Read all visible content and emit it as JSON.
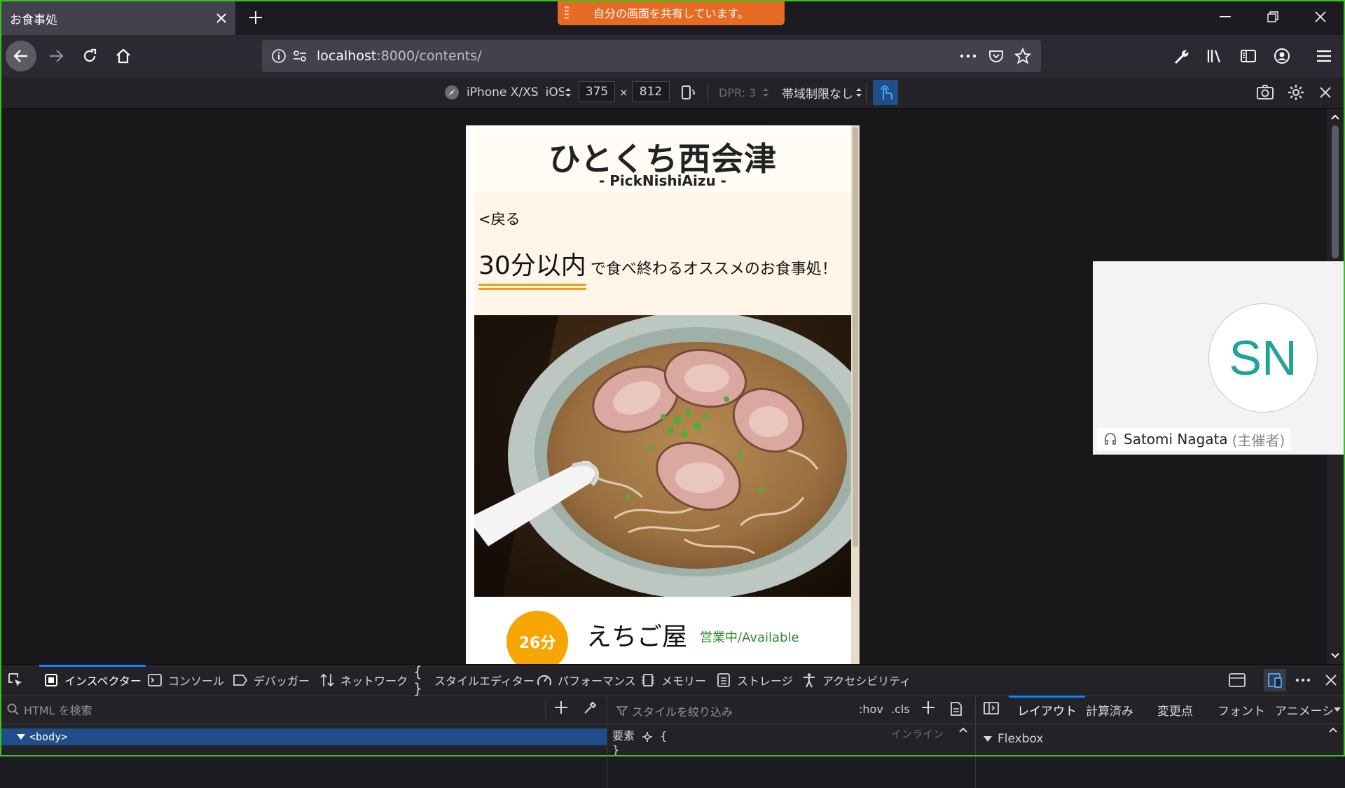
{
  "browser": {
    "tab_title": "お食事処",
    "share_banner": "自分の画面を共有しています。",
    "url_host": "localhost",
    "url_rest": ":8000/contents/"
  },
  "rdm": {
    "device": "iPhone X/XS",
    "os": "iOS",
    "width": "375",
    "times": "×",
    "height": "812",
    "dpr": "DPR: 3",
    "throttle": "帯域制限なし"
  },
  "page": {
    "site_title": "ひとくち西会津",
    "site_subtitle": "- PickNishiAizu -",
    "back_link": "<戻る",
    "headline_big": "30分以内",
    "headline_small": "で食べ終わるオススメのお食事処！",
    "shop": {
      "time": "26分",
      "name": "えちご屋",
      "status": "営業中/Available"
    }
  },
  "meeting": {
    "initials": "SN",
    "name": "Satomi Nagata",
    "role": "(主催者)"
  },
  "devtools": {
    "tabs": [
      "インスペクター",
      "コンソール",
      "デバッガー",
      "ネットワーク",
      "スタイルエディター",
      "パフォーマンス",
      "メモリー",
      "ストレージ",
      "アクセシビリティ"
    ],
    "html_search_placeholder": "HTML を検索",
    "style_filter_placeholder": "スタイルを絞り込み",
    "hov": ":hov",
    "cls": ".cls",
    "side_tabs": [
      "レイアウト",
      "計算済み",
      "変更点",
      "フォント",
      "アニメーショ"
    ],
    "body_node": "<body>",
    "rule_selector": "要素",
    "rule_open": "{",
    "rule_close": "}",
    "inline_label": "インライン",
    "flexbox_label": "Flexbox"
  },
  "colors": {
    "accent_orange": "#f7a500",
    "share_banner": "#e66b24",
    "status_green": "#2e8b2e",
    "avatar_teal": "#21a39a",
    "selection_blue": "#204e8a"
  }
}
